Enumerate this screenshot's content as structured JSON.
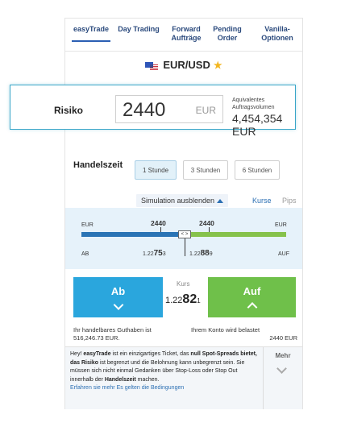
{
  "tabs": [
    {
      "label": "easyTrade"
    },
    {
      "label": "Day Trading"
    },
    {
      "label": "Forward Aufträge"
    },
    {
      "label": "Pending Order"
    },
    {
      "label": "Vanilla-Optionen"
    }
  ],
  "instrument": {
    "pair": "EUR/USD",
    "favorite_icon": "star-icon"
  },
  "risk": {
    "label": "Risiko",
    "value": "2440",
    "currency": "EUR",
    "volume_label": "Aquivalentes Auftragsvolumen",
    "volume_value": "4,454,354 EUR"
  },
  "horizon": {
    "label": "Handelszeit",
    "options": [
      "1 Stunde",
      "3 Stunden",
      "6 Stunden"
    ],
    "selected": "1 Stunde"
  },
  "simulation": {
    "toggle_label": "Simulation ausblenden",
    "view_kurse": "Kurse",
    "view_pips": "Pips",
    "left_currency": "EUR",
    "right_currency": "EUR",
    "left_amount": "2440",
    "right_amount": "2440",
    "left_side": "AB",
    "right_side": "AUF",
    "left_price_prefix": "1.22",
    "left_price_big": "75",
    "left_price_suffix": "3",
    "right_price_prefix": "1.22",
    "right_price_big": "88",
    "right_price_suffix": "9",
    "handle_glyph": "< >"
  },
  "trade": {
    "sell_label": "Ab",
    "buy_label": "Auf",
    "rate_label": "Kurs",
    "rate_prefix": "1.22",
    "rate_big": "82",
    "rate_suffix": "1"
  },
  "balance": {
    "text": "Ihr handelbares Guthaben ist 516,246.73 EUR.",
    "debit_text": "Ihrem Konto wird belastet",
    "debit_value": "2440 EUR"
  },
  "promo": {
    "p1": "Hey! ",
    "p2": "easyTrade",
    "p3": " ist ein einzigartiges Ticket, das ",
    "p4": "null Spot-Spreads bietet, das Risiko",
    "p5": " ist begrenzt und die Belohnung kann unbegrenzt sein. Sie müssen sich nicht einmal Gedanken über Stop-Loss oder Stop Out innerhalb der ",
    "p6": "Handelszeit",
    "p7": " machen.",
    "link": "Erfahren sie mehr Es gelten die Bedingungen",
    "more_label": "Mehr"
  },
  "colors": {
    "sell": "#2aa6dd",
    "buy": "#6fc04a",
    "accent": "#2b6fb3",
    "highlight_border": "#3aa6c8"
  }
}
